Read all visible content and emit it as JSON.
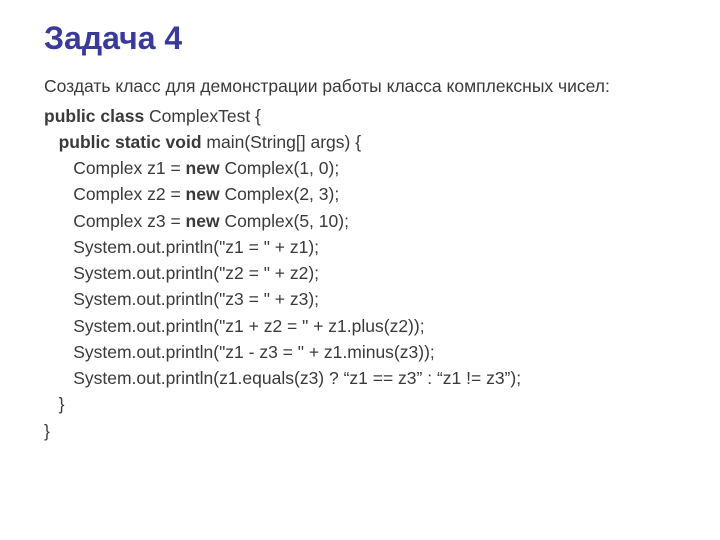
{
  "title": "Задача 4",
  "intro": "Создать класс для демонстрации работы класса комплексных чисел:",
  "code": {
    "l1": {
      "kw": "public class ",
      "rest": "ComplexTest {"
    },
    "l2": {
      "indent": "   ",
      "kw": "public static void ",
      "rest": "main(String[] args) {"
    },
    "l3": {
      "indent": "      ",
      "pre": "Complex z1 = ",
      "kw": "new ",
      "rest": "Complex(1, 0);"
    },
    "l4": {
      "indent": "      ",
      "pre": "Complex z2 = ",
      "kw": "new ",
      "rest": "Complex(2, 3);"
    },
    "l5": {
      "indent": "      ",
      "pre": "Complex z3 = ",
      "kw": "new ",
      "rest": "Complex(5, 10);"
    },
    "l6": {
      "indent": "      ",
      "rest": "System.out.println(\"z1 = \" + z1);"
    },
    "l7": {
      "indent": "      ",
      "rest": "System.out.println(\"z2 = \" + z2);"
    },
    "l8": {
      "indent": "      ",
      "rest": "System.out.println(\"z3 = \" + z3);"
    },
    "l9": {
      "indent": "      ",
      "rest": "System.out.println(\"z1 + z2 = \" + z1.plus(z2));"
    },
    "l10": {
      "indent": "      ",
      "rest": "System.out.println(\"z1 - z3 = \" + z1.minus(z3));"
    },
    "l11": {
      "indent": "      ",
      "rest": "System.out.println(z1.equals(z3) ? “z1 == z3” : “z1 != z3”);"
    },
    "l12": {
      "indent": "   ",
      "rest": "}"
    },
    "l13": {
      "rest": "}"
    }
  }
}
